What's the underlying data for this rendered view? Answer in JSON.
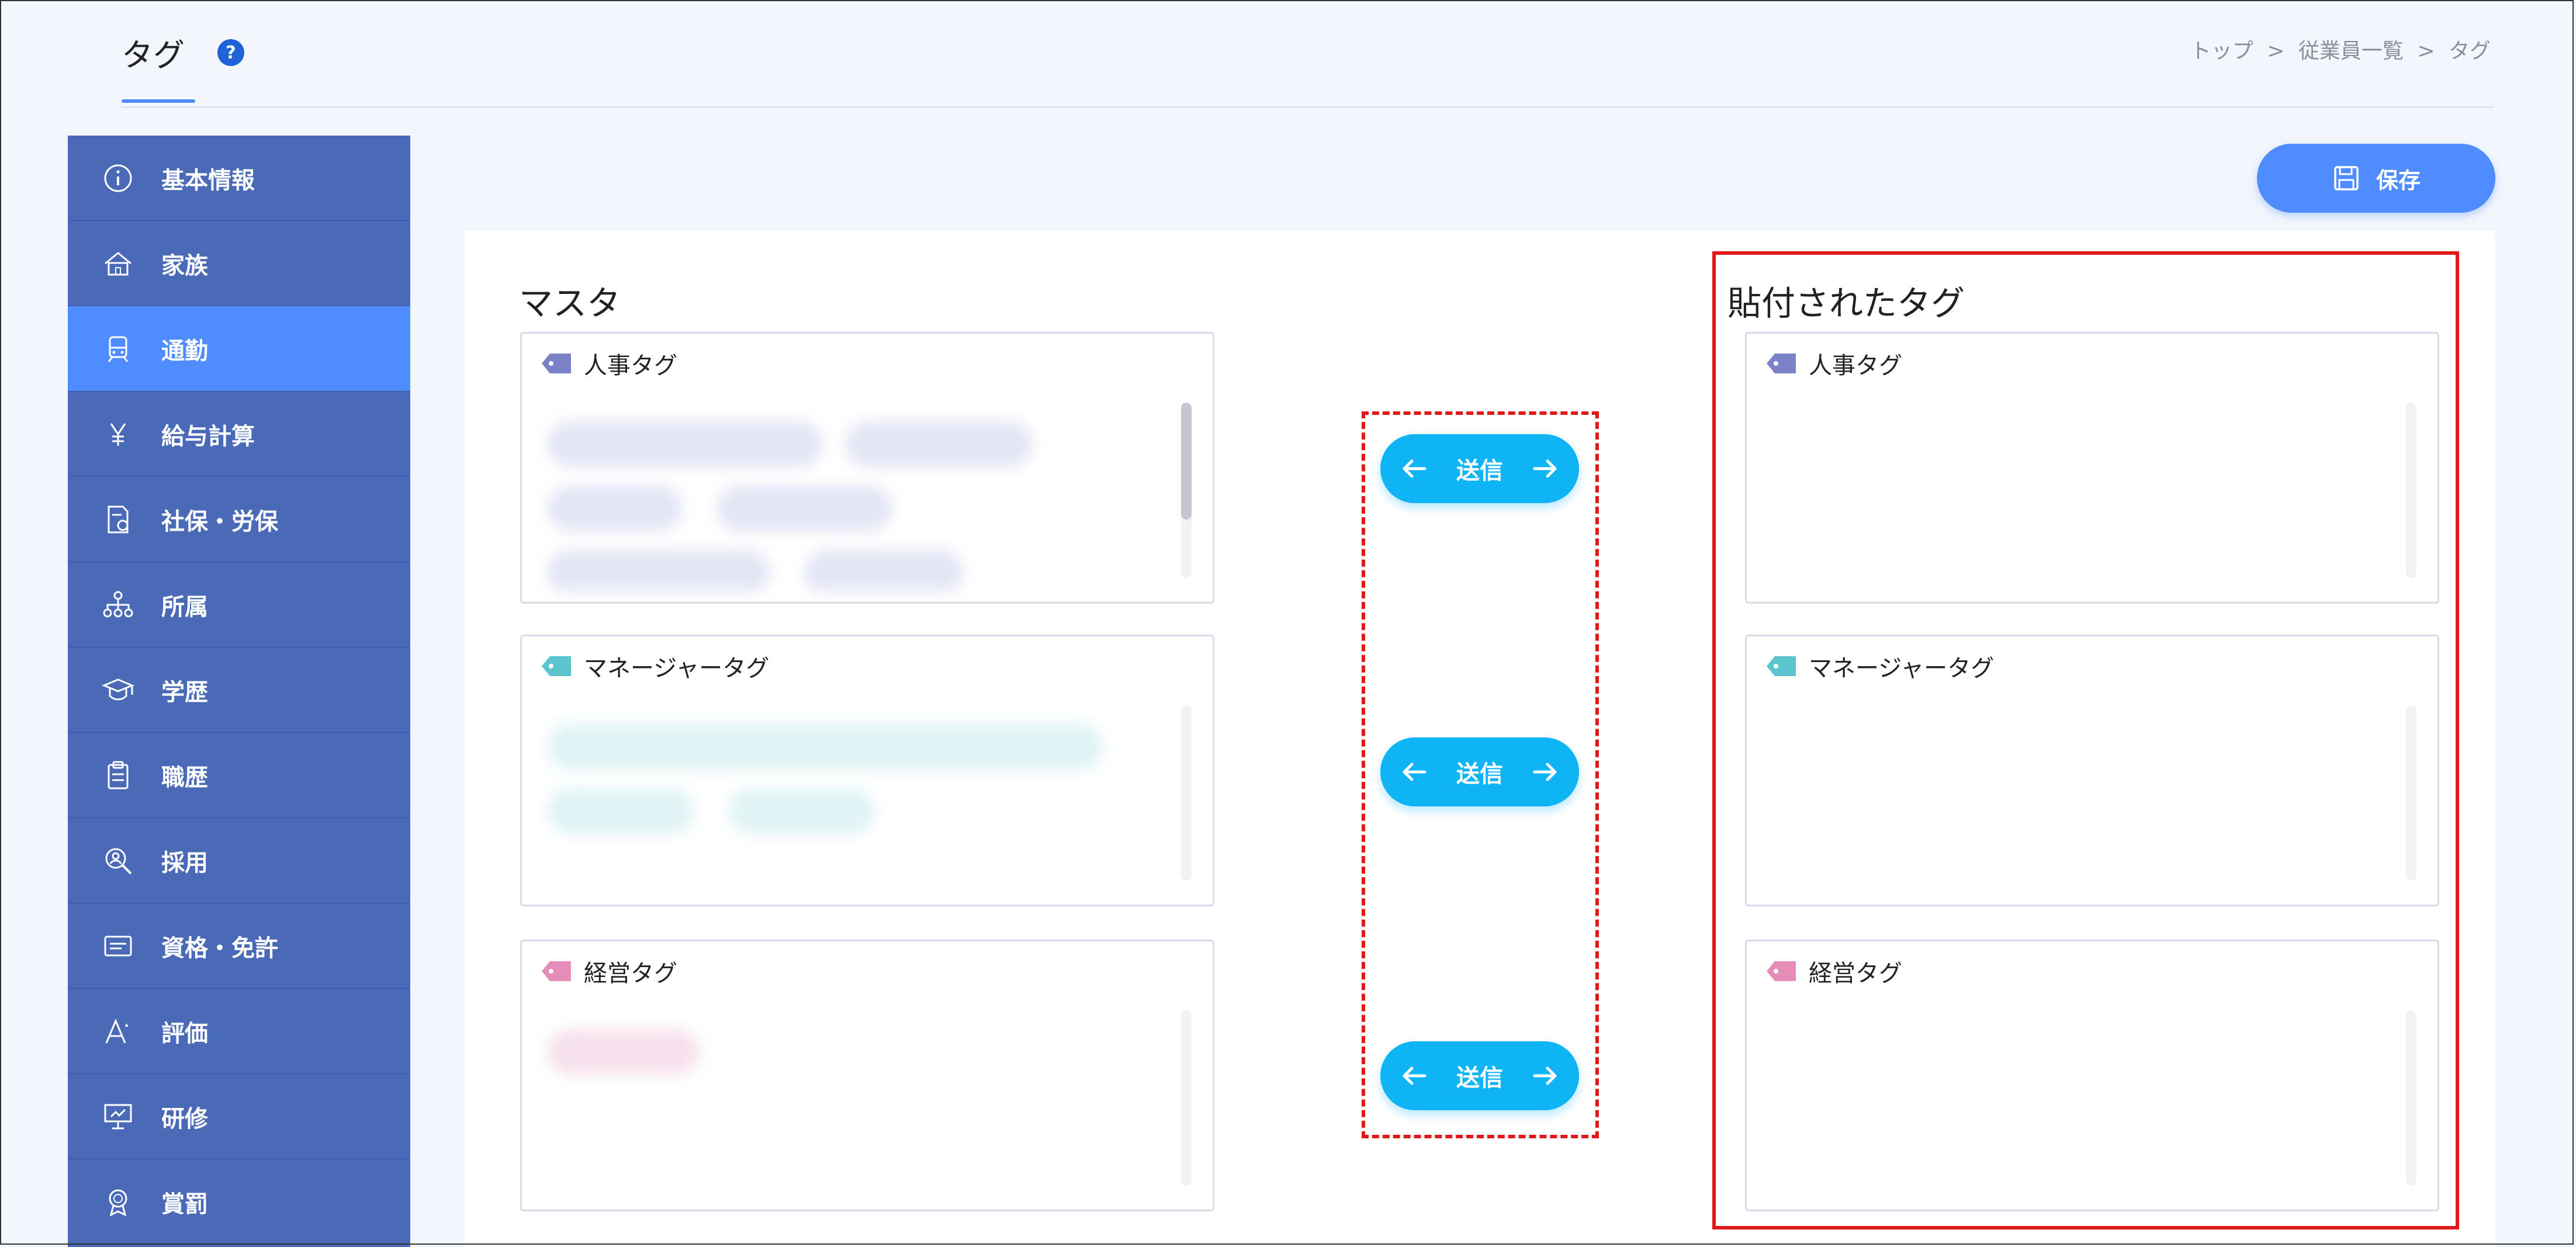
{
  "header": {
    "title": "タグ",
    "breadcrumb": [
      "トップ",
      "従業員一覧",
      "タグ"
    ],
    "breadcrumb_sep": ">"
  },
  "sidebar": {
    "items": [
      {
        "label": "基本情報",
        "icon": "info-icon",
        "active": false
      },
      {
        "label": "家族",
        "icon": "house-icon",
        "active": false
      },
      {
        "label": "通勤",
        "icon": "train-icon",
        "active": true
      },
      {
        "label": "給与計算",
        "icon": "yen-icon",
        "active": false
      },
      {
        "label": "社保・労保",
        "icon": "insurance-icon",
        "active": false
      },
      {
        "label": "所属",
        "icon": "org-chart-icon",
        "active": false
      },
      {
        "label": "学歴",
        "icon": "graduation-cap-icon",
        "active": false
      },
      {
        "label": "職歴",
        "icon": "clipboard-icon",
        "active": false
      },
      {
        "label": "採用",
        "icon": "recruit-magnifier-icon",
        "active": false
      },
      {
        "label": "資格・免許",
        "icon": "license-card-icon",
        "active": false
      },
      {
        "label": "評価",
        "icon": "evaluation-icon",
        "active": false
      },
      {
        "label": "研修",
        "icon": "training-board-icon",
        "active": false
      },
      {
        "label": "賞罰",
        "icon": "award-icon",
        "active": false
      }
    ]
  },
  "toolbar": {
    "save_label": "保存"
  },
  "master": {
    "title": "マスタ",
    "groups": [
      {
        "label": "人事タグ",
        "color": "#7b82c8"
      },
      {
        "label": "マネージャータグ",
        "color": "#5bc4cf"
      },
      {
        "label": "経営タグ",
        "color": "#e58db8"
      }
    ]
  },
  "attached": {
    "title": "貼付されたタグ",
    "groups": [
      {
        "label": "人事タグ",
        "color": "#7b82c8"
      },
      {
        "label": "マネージャータグ",
        "color": "#5bc4cf"
      },
      {
        "label": "経営タグ",
        "color": "#e58db8"
      }
    ]
  },
  "send_buttons": [
    {
      "label": "送信"
    },
    {
      "label": "送信"
    },
    {
      "label": "送信"
    }
  ],
  "colors": {
    "sidebar_bg": "#4a6ab8",
    "sidebar_active": "#4f8cff",
    "accent": "#4f8cff",
    "send_button": "#0fb4f5",
    "highlight_red": "#e01818"
  }
}
